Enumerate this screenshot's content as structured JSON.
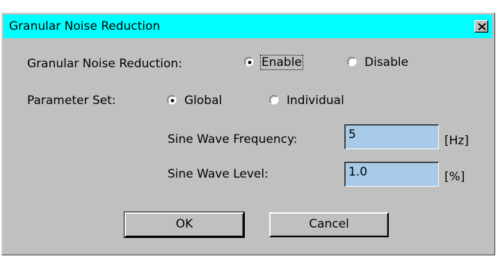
{
  "window": {
    "title": "Granular Noise Reduction",
    "titlebar_color": "#00ffff",
    "close_icon": "close-icon"
  },
  "gnr": {
    "label": "Granular Noise Reduction:",
    "options": [
      {
        "label": "Enable",
        "selected": true,
        "focused": true
      },
      {
        "label": "Disable",
        "selected": false,
        "focused": false
      }
    ]
  },
  "param": {
    "label": "Parameter Set:",
    "options": [
      {
        "label": "Global",
        "selected": true
      },
      {
        "label": "Individual",
        "selected": false
      }
    ]
  },
  "fields": {
    "freq": {
      "label": "Sine Wave Frequency:",
      "value": "5",
      "unit": "[Hz]"
    },
    "level": {
      "label": "Sine Wave Level:",
      "value": "1.0",
      "unit": "[%]"
    },
    "field_color": "#a6cae8"
  },
  "buttons": {
    "ok": "OK",
    "cancel": "Cancel"
  }
}
